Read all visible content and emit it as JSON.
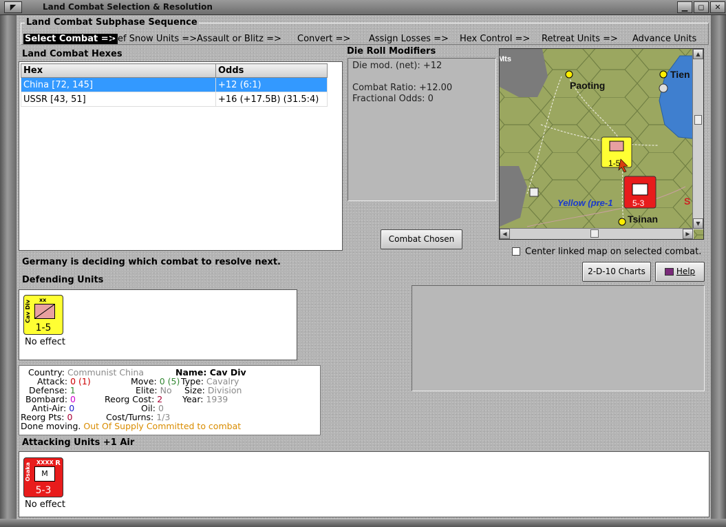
{
  "window": {
    "title": "Land Combat Selection & Resolution"
  },
  "subphase": {
    "legend": "Land Combat Subphase Sequence",
    "steps": [
      "Select Combat =>",
      "Def Snow Units =>",
      "Assault or Blitz =>",
      "Convert =>",
      "Assign Losses =>",
      "Hex Control =>",
      "Retreat Units =>",
      "Advance Units"
    ]
  },
  "hexes": {
    "label": "Land Combat Hexes",
    "columns": [
      "Hex",
      "Odds"
    ],
    "rows": [
      {
        "hex": "China [72, 145]",
        "odds": "+12 (6:1)"
      },
      {
        "hex": "USSR [43, 51]",
        "odds": "+16 (+17.5B) (31.5:4)"
      }
    ]
  },
  "die_roll": {
    "label": "Die Roll Modifiers",
    "lines": [
      "Die mod. (net): +12",
      "",
      "Combat Ratio: +12.00",
      "Fractional Odds: 0"
    ]
  },
  "map": {
    "labels": {
      "mts": "Mts",
      "paoting": "Paoting",
      "tien": "Tien",
      "tsinan": "Tsinan",
      "river": "Yellow (pre-1",
      "edge": "S"
    },
    "colors": {
      "grass": "#9ba760",
      "mountain": "#7b7b7b",
      "water": "#3f7fcf"
    }
  },
  "buttons": {
    "combat_chosen": "Combat Chosen",
    "charts": "2-D-10 Charts",
    "help": "Help"
  },
  "center_map": {
    "label": "Center linked map on selected combat."
  },
  "status": {
    "message": "Germany is deciding which combat to resolve next."
  },
  "defending": {
    "label": "Defending Units",
    "unit": {
      "type": "Cav Div",
      "size": "xx",
      "strength": "1-5",
      "color": "#ffff33",
      "result": "No effect"
    }
  },
  "unit_info": {
    "country_label": "Country:",
    "country": "Communist China",
    "name_label": "Name:",
    "name": "Cav Div",
    "attack_label": "Attack:",
    "attack": "0",
    "attack_extra": "(1)",
    "move_label": "Move:",
    "move": "0",
    "move_extra": "(5)",
    "type_label": "Type:",
    "type": "Cavalry",
    "defense_label": "Defense:",
    "defense": "1",
    "elite_label": "Elite:",
    "elite": "No",
    "size_label": "Size:",
    "size": "Division",
    "bombard_label": "Bombard:",
    "bombard": "0",
    "reorg_cost_label": "Reorg Cost:",
    "reorg_cost": "2",
    "year_label": "Year:",
    "year": "1939",
    "anti_air_label": "Anti-Air:",
    "anti_air": "0",
    "oil_label": "Oil:",
    "oil": "0",
    "reorg_pts_label": "Reorg Pts:",
    "reorg_pts": "0",
    "cost_turns_label": "Cost/Turns:",
    "cost_turns": "1/3",
    "done_moving": "Done moving.",
    "supply": "Out Of Supply",
    "committed": "Committed to combat"
  },
  "attacking": {
    "label": "Attacking Units +1 Air",
    "unit": {
      "type": "Osaka",
      "size": "XXXX",
      "marker": "R",
      "symbol": "M",
      "strength": "5-3",
      "color": "#e81c1c",
      "result": "No effect"
    }
  }
}
